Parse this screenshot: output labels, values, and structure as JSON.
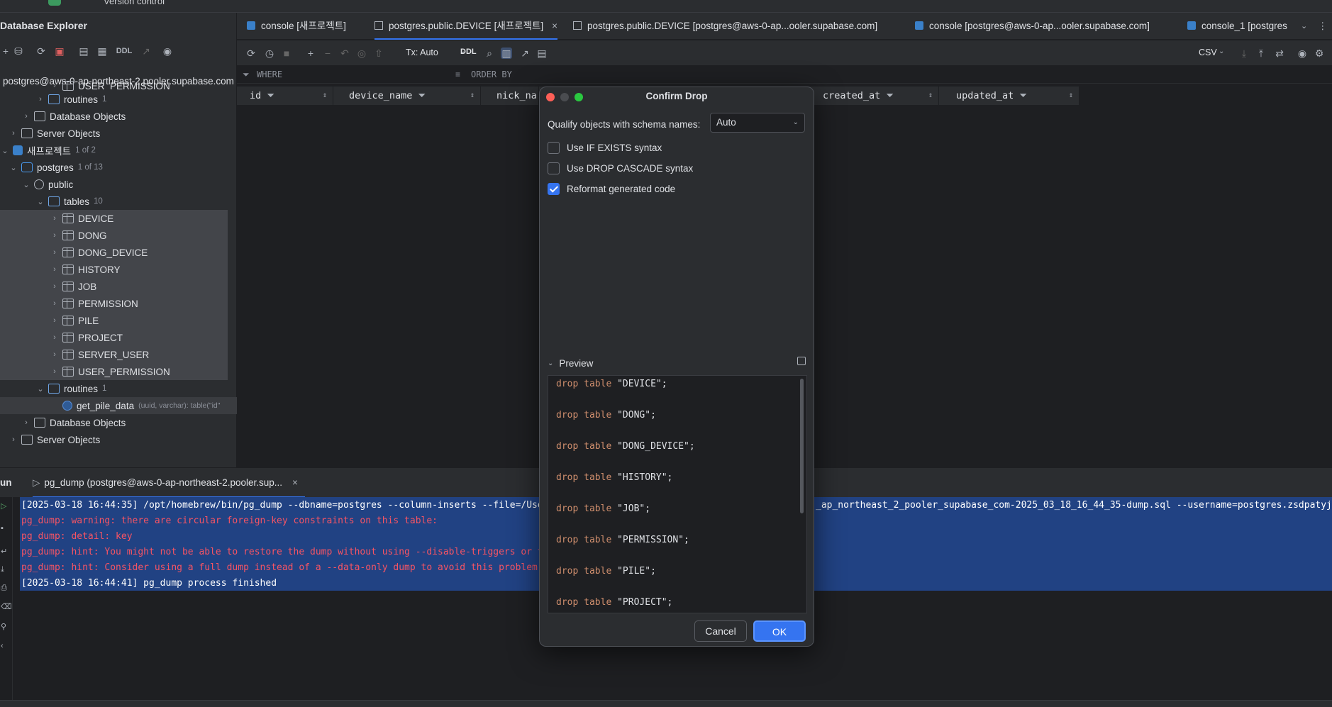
{
  "top": {
    "vcs_label": "Version control"
  },
  "explorer": {
    "title": "Database Explorer",
    "ddl_label": "DDL",
    "rows": [
      {
        "label": "postgres@aws-0-ap-northeast-2.pooler.supabase.com",
        "badge": ""
      },
      {
        "label": "USER_PERMISSION",
        "badge": ""
      },
      {
        "label": "routines",
        "badge": "1"
      },
      {
        "label": "Database Objects",
        "badge": ""
      },
      {
        "label": "Server Objects",
        "badge": ""
      },
      {
        "label": "새프로젝트",
        "badge": "1 of 2"
      },
      {
        "label": "postgres",
        "badge": "1 of 13"
      },
      {
        "label": "public",
        "badge": ""
      },
      {
        "label": "tables",
        "badge": "10"
      },
      {
        "label": "DEVICE",
        "badge": ""
      },
      {
        "label": "DONG",
        "badge": ""
      },
      {
        "label": "DONG_DEVICE",
        "badge": ""
      },
      {
        "label": "HISTORY",
        "badge": ""
      },
      {
        "label": "JOB",
        "badge": ""
      },
      {
        "label": "PERMISSION",
        "badge": ""
      },
      {
        "label": "PILE",
        "badge": ""
      },
      {
        "label": "PROJECT",
        "badge": ""
      },
      {
        "label": "SERVER_USER",
        "badge": ""
      },
      {
        "label": "USER_PERMISSION",
        "badge": ""
      },
      {
        "label": "routines",
        "badge": "1"
      },
      {
        "label": "get_pile_data",
        "badge": "(uuid, varchar): table(\"id\""
      },
      {
        "label": "Database Objects",
        "badge": ""
      },
      {
        "label": "Server Objects",
        "badge": ""
      }
    ]
  },
  "tabs": [
    {
      "label": "console [새프로젝트]"
    },
    {
      "label": "postgres.public.DEVICE [새프로젝트]"
    },
    {
      "label": "postgres.public.DEVICE [postgres@aws-0-ap...ooler.supabase.com]"
    },
    {
      "label": "console [postgres@aws-0-ap...ooler.supabase.com]"
    },
    {
      "label": "console_1 [postgres"
    }
  ],
  "data_toolbar": {
    "tx_label": "Tx: Auto",
    "ddl_label": "DDL",
    "export_format": "CSV"
  },
  "filter": {
    "where_label": "WHERE",
    "order_label": "ORDER BY"
  },
  "columns": [
    {
      "name": "id"
    },
    {
      "name": "device_name"
    },
    {
      "name": "nick_na"
    },
    {
      "name": "created_at"
    },
    {
      "name": "updated_at"
    }
  ],
  "run": {
    "title": "un",
    "tab_label": "pg_dump (postgres@aws-0-ap-northeast-2.pooler.sup...",
    "lines": [
      {
        "text": "[2025-03-18 16:44:35] /opt/homebrew/bin/pg_dump --dbname=postgres --column-inserts --file=/Use",
        "tail": "_ap_northeast_2_pooler_supabase_com-2025_03_18_16_44_35-dump.sql --username=postgres.zsdpatyjo"
      },
      {
        "text": "pg_dump: warning: there are circular foreign-key constraints on this table:",
        "tail": ""
      },
      {
        "text": "pg_dump: detail: key",
        "tail": ""
      },
      {
        "text": "pg_dump: hint: You might not be able to restore the dump without using --disable-triggers or t",
        "tail": ""
      },
      {
        "text": "pg_dump: hint: Consider using a full dump instead of a --data-only dump to avoid this problem",
        "tail": ""
      },
      {
        "text": "[2025-03-18 16:44:41] pg_dump process finished",
        "tail": ""
      }
    ]
  },
  "dialog": {
    "title": "Confirm Drop",
    "qualify_label": "Qualify objects with schema names:",
    "qualify_value": "Auto",
    "options": [
      {
        "label": "Use IF EXISTS syntax",
        "checked": false
      },
      {
        "label": "Use DROP CASCADE syntax",
        "checked": false
      },
      {
        "label": "Reformat generated code",
        "checked": true
      }
    ],
    "preview_label": "Preview",
    "preview_lines": [
      {
        "kw": "drop table",
        "name": "\"DEVICE\";"
      },
      {
        "kw": "drop table",
        "name": "\"DONG\";"
      },
      {
        "kw": "drop table",
        "name": "\"DONG_DEVICE\";"
      },
      {
        "kw": "drop table",
        "name": "\"HISTORY\";"
      },
      {
        "kw": "drop table",
        "name": "\"JOB\";"
      },
      {
        "kw": "drop table",
        "name": "\"PERMISSION\";"
      },
      {
        "kw": "drop table",
        "name": "\"PILE\";"
      },
      {
        "kw": "drop table",
        "name": "\"PROJECT\";"
      }
    ],
    "cancel_label": "Cancel",
    "ok_label": "OK"
  },
  "colors": {
    "accent": "#3574f0",
    "error_text": "#f75464",
    "keyword": "#cf8e6d",
    "selection": "#214283"
  }
}
